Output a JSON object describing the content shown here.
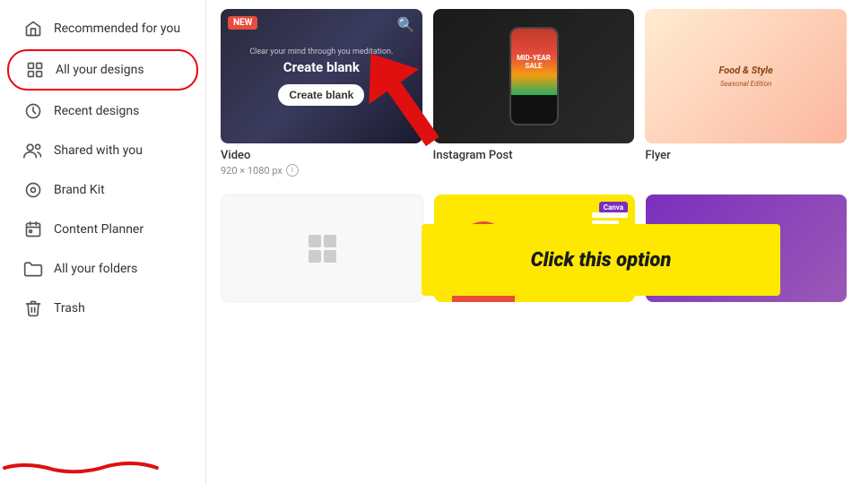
{
  "sidebar": {
    "items": [
      {
        "id": "recommended",
        "label": "Recommended for you",
        "icon": "home"
      },
      {
        "id": "all-designs",
        "label": "All your designs",
        "icon": "grid",
        "highlighted": true
      },
      {
        "id": "recent",
        "label": "Recent designs",
        "icon": "clock"
      },
      {
        "id": "shared",
        "label": "Shared with you",
        "icon": "people"
      },
      {
        "id": "brand-kit",
        "label": "Brand Kit",
        "icon": "brand"
      },
      {
        "id": "content-planner",
        "label": "Content Planner",
        "icon": "calendar"
      },
      {
        "id": "folders",
        "label": "All your folders",
        "icon": "folder"
      },
      {
        "id": "trash",
        "label": "Trash",
        "icon": "trash"
      }
    ]
  },
  "main": {
    "cards": [
      {
        "id": "video",
        "badge": "NEW",
        "title": "Video",
        "subtitle": "920 × 1080 px",
        "type": "video"
      },
      {
        "id": "instagram",
        "title": "Instagram Post",
        "type": "instagram"
      },
      {
        "id": "flyer",
        "title": "Flyer",
        "type": "flyer"
      }
    ],
    "banner": {
      "text": "Click this option"
    },
    "video_inner": {
      "small_text": "Clear your mind through you meditation.",
      "big_text": "Create blank",
      "btn_label": "Create blank"
    },
    "insta_inner": {
      "text": "MID-YEAR SALE"
    }
  }
}
